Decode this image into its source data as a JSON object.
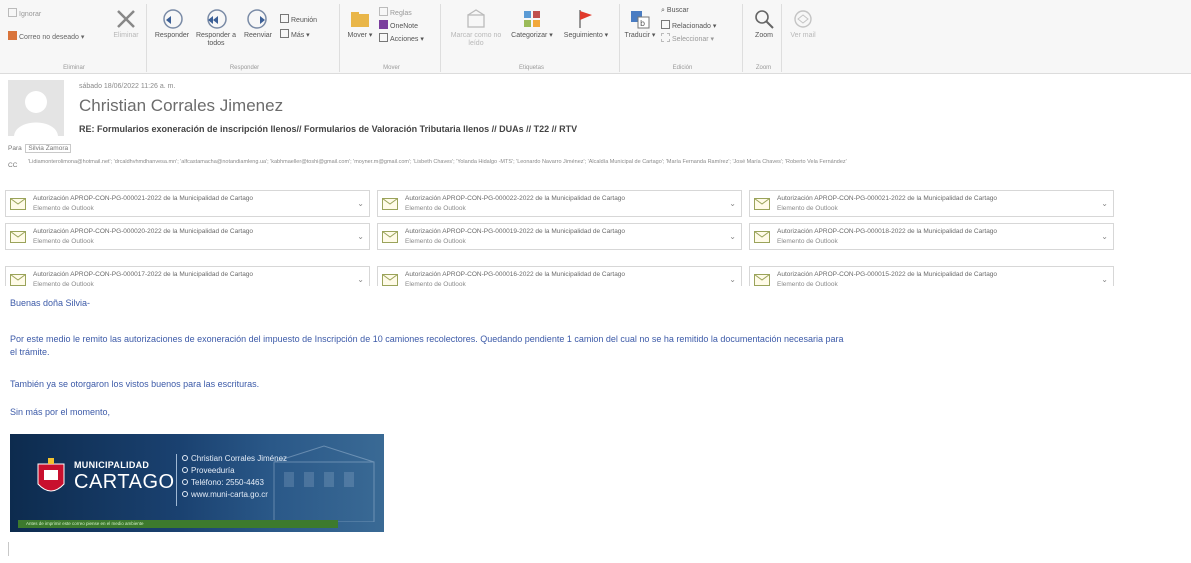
{
  "ribbon": {
    "ignore": "Ignorar",
    "junk": "Correo no deseado",
    "delete": "Eliminar",
    "group_delete": "Eliminar",
    "reply": "Responder",
    "reply_all": "Responder a todos",
    "forward": "Reenviar",
    "meeting": "Reunión",
    "more": "Más",
    "group_respond": "Responder",
    "move": "Mover",
    "onenote": "OneNote",
    "rules": "Reglas",
    "actions": "Acciones",
    "group_move": "Mover",
    "mark_unread": "Marcar como no leído",
    "categorize": "Categorizar",
    "followup": "Seguimiento",
    "group_tags": "Etiquetas",
    "translate": "Traducir",
    "find": "Buscar",
    "related": "Relacionado",
    "select": "Seleccionar",
    "group_edit": "Edición",
    "zoom": "Zoom",
    "group_zoom": "Zoom",
    "view_mail": "Ver mail"
  },
  "message": {
    "date": "sábado 18/06/2022 11:26 a. m.",
    "sender": "Christian Corrales Jimenez",
    "subject": "RE: Formularios exoneración de inscripción llenos// Formularios de Valoración Tributaria llenos // DUAs // T22 // RTV",
    "to_label": "Para",
    "to": "Silvia Zamora",
    "cc_label": "CC",
    "cc": "'Lidiamonterolimona@hotmail.net'; 'drcaldhvhmdhanvesa.mn'; 'alfcastamacha@notandiamleng.ua'; 'kabhmaeller@toshi@gmail.com'; 'moyner.m@gmail.com'; 'Lisbeth Chaves'; 'Yolanda Hidalgo -MTS'; 'Leonardo Navarro Jiménez'; 'Alcaldía Municipal de Cartago'; 'María Fernanda Ramírez'; 'José María Chaves'; 'Roberto Vela Fernández'"
  },
  "attachments": [
    {
      "name": "Autorización APROP-CON-PG-000021-2022 de la Municipalidad de Cartago",
      "type": "Elemento de Outlook"
    },
    {
      "name": "Autorización APROP-CON-PG-000022-2022 de la Municipalidad de Cartago",
      "type": "Elemento de Outlook"
    },
    {
      "name": "Autorización APROP-CON-PG-000021-2022 de la Municipalidad de Cartago",
      "type": "Elemento de Outlook"
    },
    {
      "name": "Autorización APROP-CON-PG-000020-2022 de la Municipalidad de Cartago",
      "type": "Elemento de Outlook"
    },
    {
      "name": "Autorización APROP-CON-PG-000019-2022 de la Municipalidad de Cartago",
      "type": "Elemento de Outlook"
    },
    {
      "name": "Autorización APROP-CON-PG-000018-2022 de la Municipalidad de Cartago",
      "type": "Elemento de Outlook"
    },
    {
      "name": "Autorización APROP-CON-PG-000017-2022 de la Municipalidad de Cartago",
      "type": "Elemento de Outlook"
    },
    {
      "name": "Autorización APROP-CON-PG-000016-2022 de la Municipalidad de Cartago",
      "type": "Elemento de Outlook"
    },
    {
      "name": "Autorización APROP-CON-PG-000015-2022 de la Municipalidad de Cartago",
      "type": "Elemento de Outlook"
    }
  ],
  "body": {
    "greeting": "Buenas doña Silvia-",
    "p1_line1": "Por este medio le remito las autorizaciones de exoneración del impuesto de Inscripción de 10 camiones recolectores. Quedando pendiente 1 camion del cual no se ha remitido la documentación necesaria para",
    "p1_line2": "el trámite.",
    "p2": "También ya se otorgaron los vistos buenos para las escrituras.",
    "p3": "Sin más por el momento,"
  },
  "signature": {
    "muni": "MUNICIPALIDAD",
    "city": "CARTAGO",
    "name": "Christian Corrales Jiménez",
    "dept": "Proveeduría",
    "phone": "Teléfono: 2550-4463",
    "web": "www.muni-carta.go.cr",
    "footer": "Antes de imprimir este correo piense en el medio ambiente"
  }
}
